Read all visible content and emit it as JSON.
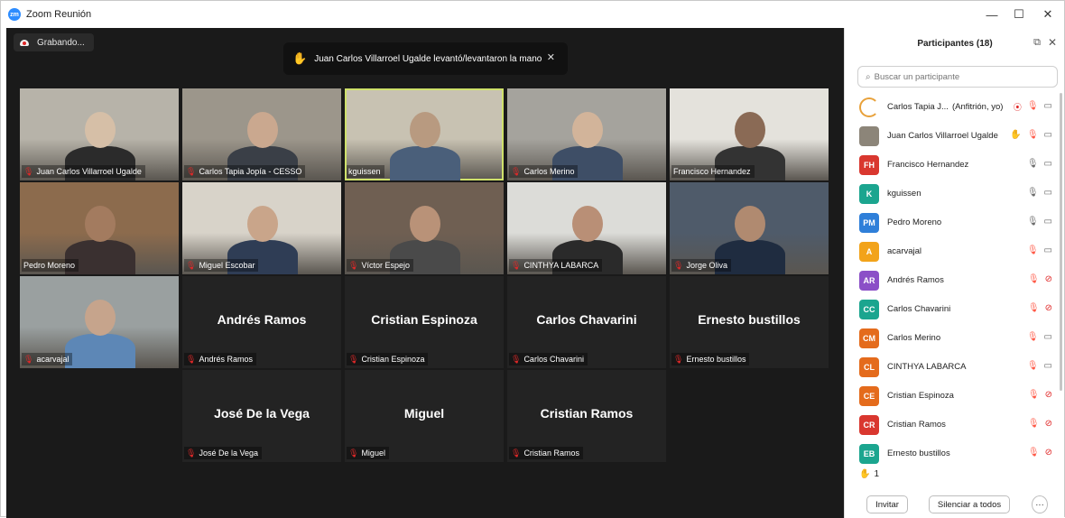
{
  "window": {
    "title": "Zoom Reunión",
    "app_icon": "zoom-logo-icon",
    "controls": [
      "—",
      "☐",
      "✕"
    ]
  },
  "recording": {
    "label": "Grabando...",
    "icon": "cloud-record-icon"
  },
  "notification": {
    "text": "Juan Carlos Villarroel Ugalde levantó/levantaron la mano",
    "icon": "raised-hand-icon",
    "close": "✕"
  },
  "gallery": {
    "tiles": [
      {
        "name": "Juan Carlos Villarroel Ugalde",
        "video": true,
        "muted": true
      },
      {
        "name": "Carlos Tapia Jopía - CESSO",
        "video": true,
        "muted": true
      },
      {
        "name": "kguissen",
        "video": true,
        "muted": false,
        "active": true
      },
      {
        "name": "Carlos Merino",
        "video": true,
        "muted": true
      },
      {
        "name": "Francisco Hernandez",
        "video": true,
        "muted": false
      },
      {
        "name": "Pedro Moreno",
        "video": true,
        "muted": false
      },
      {
        "name": "Miguel Escobar",
        "video": true,
        "muted": true
      },
      {
        "name": "Víctor Espejo",
        "video": true,
        "muted": true
      },
      {
        "name": "CINTHYA LABARCA",
        "video": true,
        "muted": true
      },
      {
        "name": "Jorge Oliva",
        "video": true,
        "muted": true
      },
      {
        "name": "acarvajal",
        "video": true,
        "muted": true
      },
      {
        "name": "Andrés Ramos",
        "video": false,
        "muted": true
      },
      {
        "name": "Cristian Espinoza",
        "video": false,
        "muted": true
      },
      {
        "name": "Carlos Chavarini",
        "video": false,
        "muted": true
      },
      {
        "name": "Ernesto bustillos",
        "video": false,
        "muted": true
      },
      {
        "name": "José De la Vega",
        "video": false,
        "muted": true
      },
      {
        "name": "Miguel",
        "video": false,
        "muted": true
      },
      {
        "name": "Cristian Ramos",
        "video": false,
        "muted": true
      }
    ]
  },
  "participants_panel": {
    "title": "Participantes (18)",
    "popout_icon": "popout-icon",
    "close_icon": "close-icon",
    "search_placeholder": "Buscar un participante",
    "participants": [
      {
        "initials": "",
        "color": "",
        "name": "Carlos Tapia J...",
        "role": "(Anfitrión, yo)",
        "mic": "off",
        "cam": "on",
        "extra": "record"
      },
      {
        "initials": "",
        "color": "",
        "name": "Juan Carlos Villarroel Ugalde",
        "role": "",
        "mic": "off",
        "cam": "on",
        "extra": "hand"
      },
      {
        "initials": "FH",
        "color": "#d9372f",
        "name": "Francisco Hernandez",
        "role": "",
        "mic": "on",
        "cam": "on",
        "extra": ""
      },
      {
        "initials": "K",
        "color": "#1ba58f",
        "name": "kguissen",
        "role": "",
        "mic": "on",
        "cam": "on",
        "extra": ""
      },
      {
        "initials": "PM",
        "color": "#2f7fd9",
        "name": "Pedro Moreno",
        "role": "",
        "mic": "on",
        "cam": "on",
        "extra": ""
      },
      {
        "initials": "A",
        "color": "#f2a31a",
        "name": "acarvajal",
        "role": "",
        "mic": "off",
        "cam": "on",
        "extra": ""
      },
      {
        "initials": "AR",
        "color": "#8b4fc7",
        "name": "Andrés Ramos",
        "role": "",
        "mic": "off",
        "cam": "off",
        "extra": ""
      },
      {
        "initials": "CC",
        "color": "#1ba58f",
        "name": "Carlos Chavarini",
        "role": "",
        "mic": "off",
        "cam": "off",
        "extra": ""
      },
      {
        "initials": "CM",
        "color": "#e46b1c",
        "name": "Carlos Merino",
        "role": "",
        "mic": "off",
        "cam": "on",
        "extra": ""
      },
      {
        "initials": "CL",
        "color": "#e46b1c",
        "name": "CINTHYA LABARCA",
        "role": "",
        "mic": "off",
        "cam": "on",
        "extra": ""
      },
      {
        "initials": "CE",
        "color": "#e46b1c",
        "name": "Cristian Espinoza",
        "role": "",
        "mic": "off",
        "cam": "off",
        "extra": ""
      },
      {
        "initials": "CR",
        "color": "#d9372f",
        "name": "Cristian Ramos",
        "role": "",
        "mic": "off",
        "cam": "off",
        "extra": ""
      },
      {
        "initials": "EB",
        "color": "#1ba58f",
        "name": "Ernesto bustillos",
        "role": "",
        "mic": "off",
        "cam": "off",
        "extra": ""
      }
    ],
    "raised_hands_count": "1",
    "buttons": {
      "invite": "Invitar",
      "mute_all": "Silenciar a todos",
      "more": "···"
    }
  }
}
